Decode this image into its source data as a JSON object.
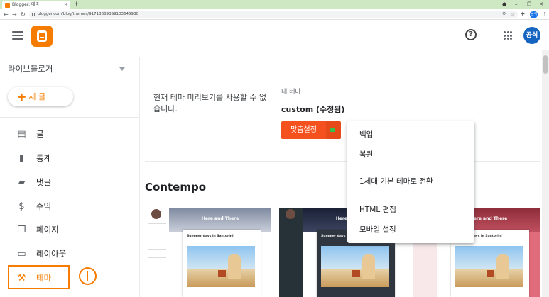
{
  "browser": {
    "tab_title": "Blogger: 테마",
    "url": "blogger.com/blog/themes/917136893S9103645930",
    "profile_initial": "공식"
  },
  "header": {
    "avatar_text": "공식"
  },
  "sidebar": {
    "blog_name": "라이브블로거",
    "new_post_label": "새 글",
    "items": [
      {
        "label": "글",
        "icon": "posts-icon"
      },
      {
        "label": "통계",
        "icon": "stats-icon"
      },
      {
        "label": "댓글",
        "icon": "comments-icon"
      },
      {
        "label": "수익",
        "icon": "earnings-icon"
      },
      {
        "label": "페이지",
        "icon": "pages-icon"
      },
      {
        "label": "레이아웃",
        "icon": "layout-icon"
      },
      {
        "label": "테마",
        "icon": "theme-icon"
      }
    ]
  },
  "main": {
    "preview_unavailable": "현재 테마 미리보기를 사용할 수 없습니다.",
    "my_theme_label": "내 테마",
    "theme_name": "custom (수정됨)",
    "customize_label": "맞춤설정",
    "section_title": "Contempo",
    "cards": [
      {
        "hero_title": "Here and There",
        "post_title": "Summer days in Santorini"
      },
      {
        "hero_title": "Here and There",
        "post_title": "Summer days in Santorini"
      },
      {
        "hero_title": "Here and There",
        "post_title": "Summer days in Santorini"
      }
    ]
  },
  "dropdown": {
    "backup": "백업",
    "restore": "복원",
    "switch_classic": "1세대 기본 테마로 전환",
    "edit_html": "HTML 편집",
    "mobile_settings": "모바일 설정"
  },
  "colors": {
    "accent": "#f57c00",
    "customize_button": "#f4511e",
    "avatar": "#1565c0"
  }
}
